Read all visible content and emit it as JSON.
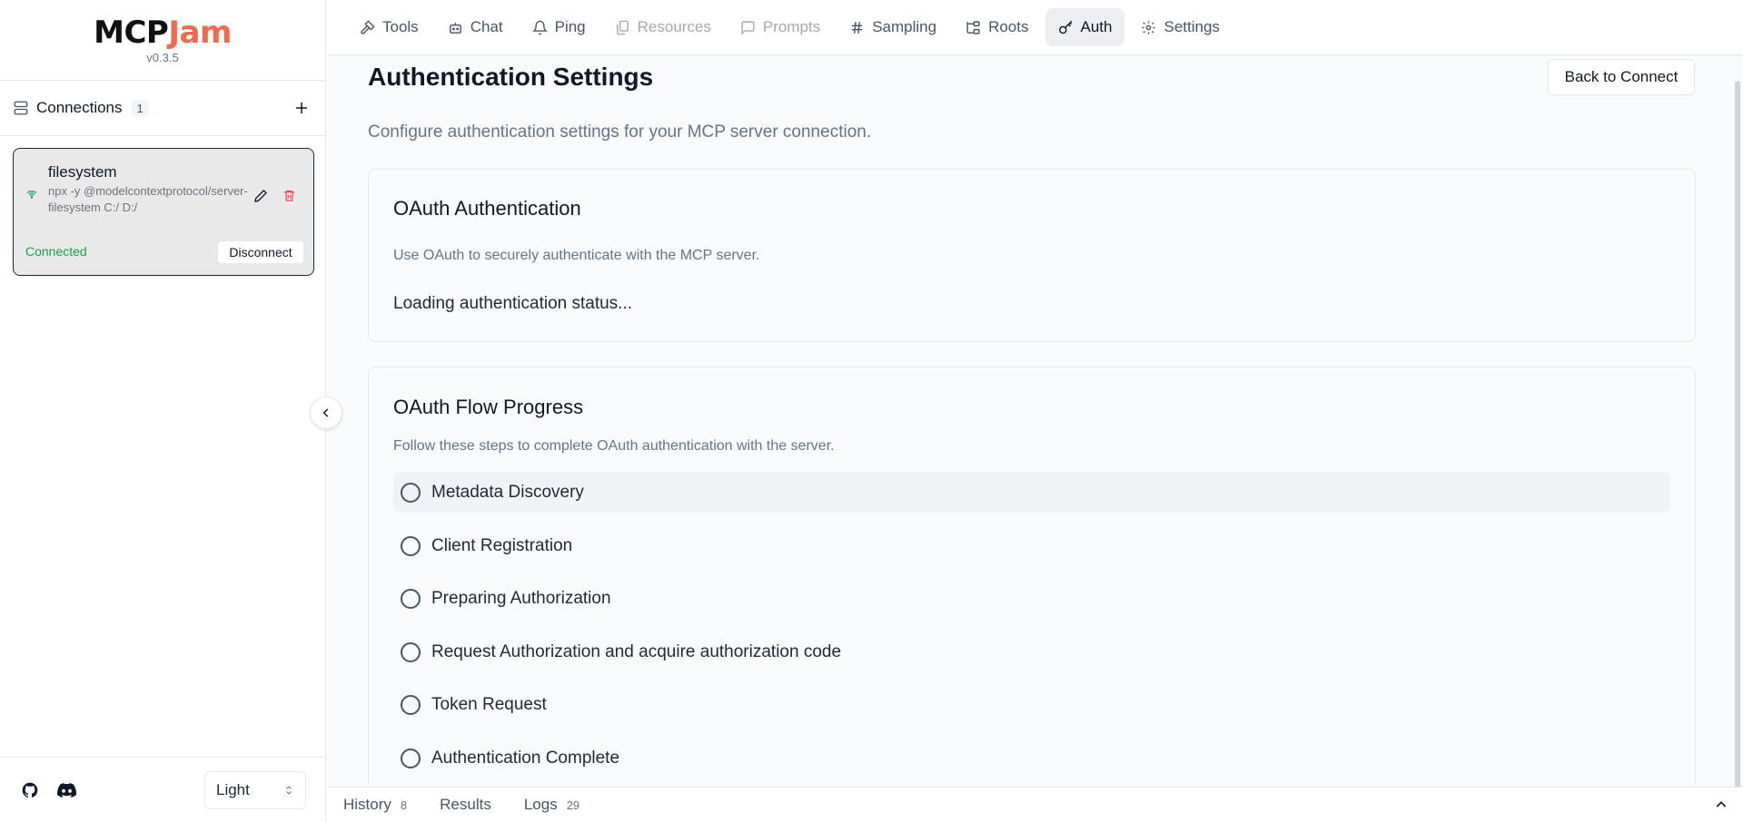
{
  "brand": {
    "logo_part1": "MCP",
    "logo_part2": "Jam",
    "version": "v0.3.5"
  },
  "sidebar": {
    "connections_title": "Connections",
    "connections_count": "1",
    "server": {
      "name": "filesystem",
      "command": "npx -y @modelcontextprotocol/server-filesystem C:/ D:/",
      "status": "Connected",
      "disconnect_label": "Disconnect"
    },
    "theme_value": "Light"
  },
  "nav": {
    "tabs": [
      {
        "label": "Tools",
        "icon": "hammer-icon",
        "state": "normal"
      },
      {
        "label": "Chat",
        "icon": "bot-icon",
        "state": "normal"
      },
      {
        "label": "Ping",
        "icon": "bell-icon",
        "state": "normal"
      },
      {
        "label": "Resources",
        "icon": "files-icon",
        "state": "disabled"
      },
      {
        "label": "Prompts",
        "icon": "message-square-icon",
        "state": "disabled"
      },
      {
        "label": "Sampling",
        "icon": "hash-icon",
        "state": "normal"
      },
      {
        "label": "Roots",
        "icon": "folder-tree-icon",
        "state": "normal"
      },
      {
        "label": "Auth",
        "icon": "key-icon",
        "state": "active"
      },
      {
        "label": "Settings",
        "icon": "gear-icon",
        "state": "normal"
      }
    ]
  },
  "main": {
    "title": "Authentication Settings",
    "back_label": "Back to Connect",
    "description": "Configure authentication settings for your MCP server connection.",
    "oauth": {
      "title": "OAuth Authentication",
      "description": "Use OAuth to securely authenticate with the MCP server.",
      "loading": "Loading authentication status..."
    },
    "flow": {
      "title": "OAuth Flow Progress",
      "description": "Follow these steps to complete OAuth authentication with the server.",
      "steps": [
        "Metadata Discovery",
        "Client Registration",
        "Preparing Authorization",
        "Request Authorization and acquire authorization code",
        "Token Request",
        "Authentication Complete"
      ]
    }
  },
  "bottom": {
    "tabs": [
      {
        "label": "History",
        "count": "8"
      },
      {
        "label": "Results",
        "count": ""
      },
      {
        "label": "Logs",
        "count": "29"
      }
    ]
  },
  "colors": {
    "accent": "#f06a4d",
    "connected": "#16a34a",
    "danger": "#ef4444"
  }
}
